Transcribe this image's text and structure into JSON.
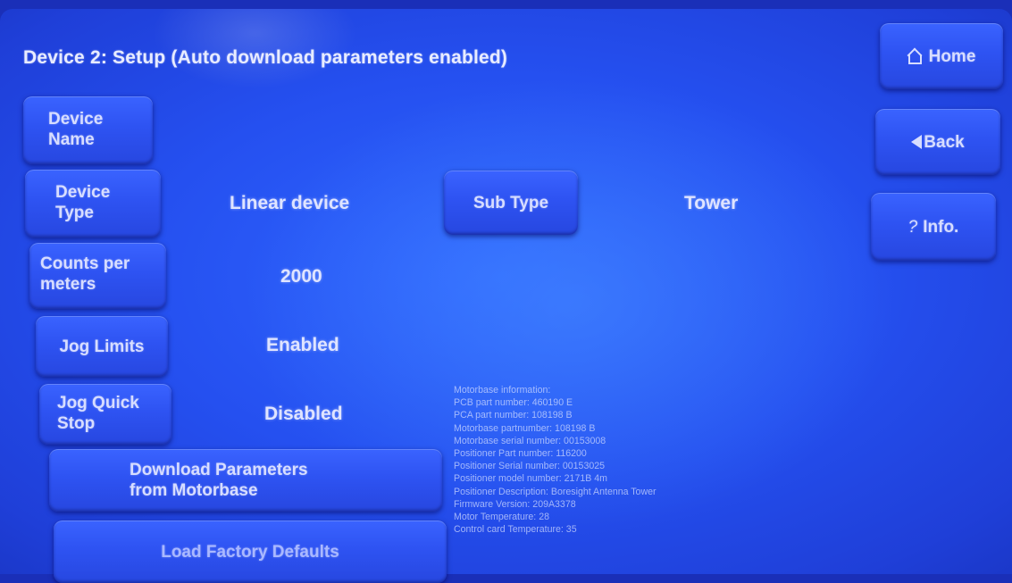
{
  "header": {
    "title": "Device 2: Setup (Auto download parameters enabled)"
  },
  "nav": {
    "home_label": "Home",
    "back_label": "Back",
    "info_label": "Info.",
    "info_glyph": "?"
  },
  "settings": {
    "device_name_label_1": "Device",
    "device_name_label_2": "Name",
    "device_type_label_1": "Device",
    "device_type_label_2": "Type",
    "device_type_value": "Linear device",
    "sub_type_label": "Sub Type",
    "sub_type_value": "Tower",
    "counts_label_1": "Counts per",
    "counts_label_2": "meters",
    "counts_value": "2000",
    "jog_limits_label": "Jog Limits",
    "jog_limits_value": "Enabled",
    "jog_quick_stop_label_1": "Jog Quick",
    "jog_quick_stop_label_2": "Stop",
    "jog_quick_stop_value": "Disabled"
  },
  "actions": {
    "download_label_1": "Download Parameters",
    "download_label_2": "from Motorbase",
    "factory_defaults_label": "Load Factory Defaults"
  },
  "motorbase_info": [
    "Motorbase information:",
    "PCB part number: 460190 E",
    "PCA part number: 108198 B",
    "Motorbase partnumber: 108198 B",
    "Motorbase serial number: 00153008",
    "Positioner Part number: 116200",
    "Positioner Serial number: 00153025",
    "Positioner model number: 2171B 4m",
    "Positioner Description: Boresight Antenna Tower",
    "Firmware Version: 209A3378",
    "Motor Temperature: 28",
    "Control card Temperature: 35"
  ],
  "colors": {
    "background": "#2550f0",
    "button": "#2e53f2",
    "text": "#d7ddff"
  }
}
